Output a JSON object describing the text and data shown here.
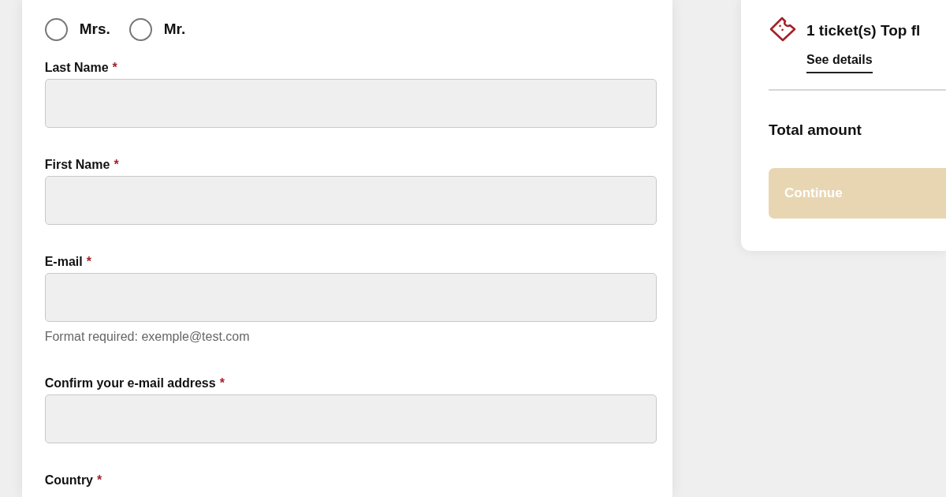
{
  "title_options": [
    {
      "label": "Mrs.",
      "selected": false
    },
    {
      "label": "Mr.",
      "selected": false
    }
  ],
  "fields": [
    {
      "kind": "input",
      "label": "Last Name",
      "required_mark": "*"
    },
    {
      "kind": "input",
      "label": "First Name",
      "required_mark": "*"
    },
    {
      "kind": "input",
      "label": "E-mail",
      "required_mark": "*",
      "hint": "Format required: exemple@test.com"
    },
    {
      "kind": "input",
      "label": "Confirm your e-mail address",
      "required_mark": "*"
    },
    {
      "kind": "label",
      "label": "Country",
      "required_mark": "*"
    }
  ],
  "summary": {
    "ticket": "1 ticket(s) Top fl",
    "details_link": "See details",
    "total_label": "Total amount",
    "continue_button": {
      "label": "Continue",
      "disabled": true
    }
  }
}
